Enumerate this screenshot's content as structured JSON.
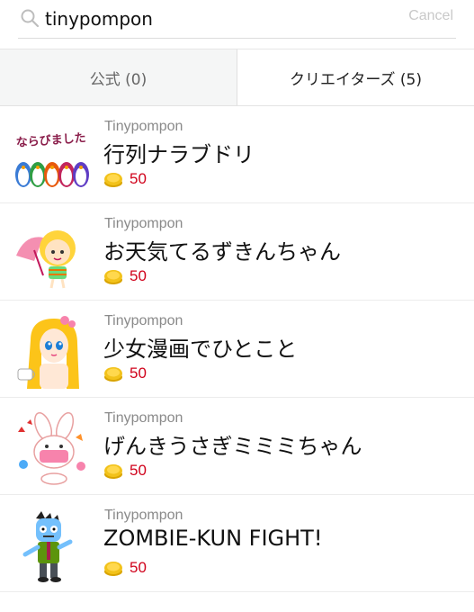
{
  "search": {
    "value": "tinypompon",
    "cancel_label": "Cancel"
  },
  "tabs": [
    {
      "label": "公式 (0)",
      "active": false
    },
    {
      "label": "クリエイターズ (5)",
      "active": true
    }
  ],
  "items": [
    {
      "creator": "Tinypompon",
      "title": "行列ナラブドリ",
      "price": "50",
      "thumb_icon": "penguins-sticker",
      "thumb_text": "ならびました"
    },
    {
      "creator": "Tinypompon",
      "title": "お天気てるずきんちゃん",
      "price": "50",
      "thumb_icon": "umbrella-girl-sticker"
    },
    {
      "creator": "Tinypompon",
      "title": "少女漫画でひとこと",
      "price": "50",
      "thumb_icon": "manga-girl-sticker"
    },
    {
      "creator": "Tinypompon",
      "title": "げんきうさぎミミミちゃん",
      "price": "50",
      "thumb_icon": "bunny-sticker"
    },
    {
      "creator": "Tinypompon",
      "title": "ZOMBIE-KUN FIGHT!",
      "price": "50",
      "thumb_icon": "zombie-sticker"
    }
  ],
  "colors": {
    "price": "#d0021b",
    "coin": "#f2c21a"
  }
}
